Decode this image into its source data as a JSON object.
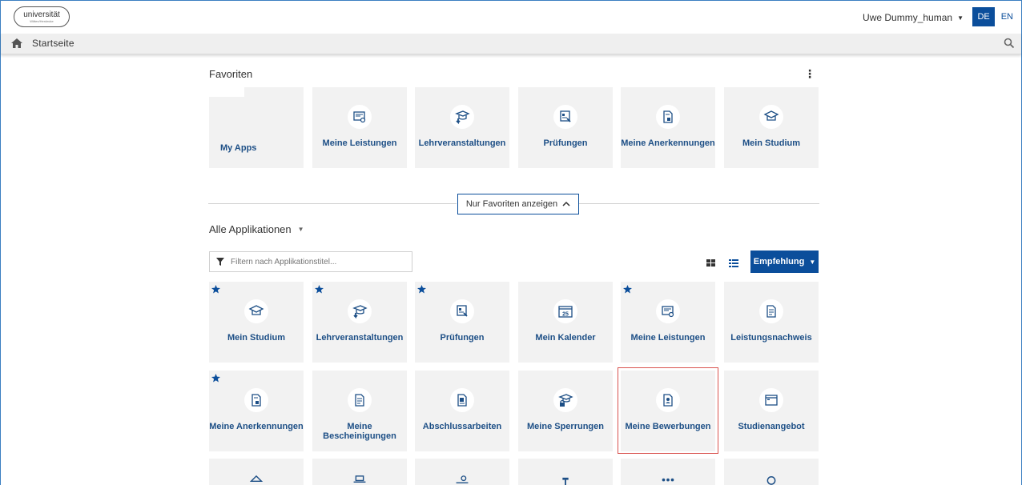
{
  "header": {
    "logo_text": "universität",
    "logo_subtext": "Witten/Herdecke",
    "user_name": "Uwe Dummy_human",
    "lang_de": "DE",
    "lang_en": "EN"
  },
  "breadcrumb": {
    "home": "Startseite"
  },
  "favorites": {
    "title": "Favoriten",
    "tiles": [
      {
        "label": "My Apps",
        "icon": "blank"
      },
      {
        "label": "Meine Leistungen",
        "icon": "certificate-icon"
      },
      {
        "label": "Lehrveranstaltungen",
        "icon": "graduation-download-icon"
      },
      {
        "label": "Prüfungen",
        "icon": "exam-icon"
      },
      {
        "label": "Meine Anerkennungen",
        "icon": "document-icon"
      },
      {
        "label": "Mein Studium",
        "icon": "graduation-cap-icon"
      }
    ],
    "toggle_label": "Nur Favoriten anzeigen"
  },
  "all_apps": {
    "title": "Alle Applikationen",
    "filter_placeholder": "Filtern nach Applikationstitel...",
    "recommend_label": "Empfehlung",
    "tiles": [
      {
        "label": "Mein Studium",
        "starred": true
      },
      {
        "label": "Lehrveranstaltungen",
        "starred": true
      },
      {
        "label": "Prüfungen",
        "starred": true
      },
      {
        "label": "Mein Kalender",
        "starred": false,
        "calendar_day": "25"
      },
      {
        "label": "Meine Leistungen",
        "starred": true
      },
      {
        "label": "Leistungsnachweis",
        "starred": false
      },
      {
        "label": "Meine Anerkennungen",
        "starred": true
      },
      {
        "label": "Meine Bescheinigungen",
        "starred": false
      },
      {
        "label": "Abschlussarbeiten",
        "starred": false
      },
      {
        "label": "Meine Sperrungen",
        "starred": false
      },
      {
        "label": "Meine Bewerbungen",
        "starred": false,
        "highlighted": true
      },
      {
        "label": "Studienangebot",
        "starred": false
      }
    ]
  },
  "colors": {
    "primary": "#0b4e9b",
    "tile_label": "#1d4f86",
    "tile_bg": "#f2f2f2",
    "highlight": "#d9534f"
  }
}
